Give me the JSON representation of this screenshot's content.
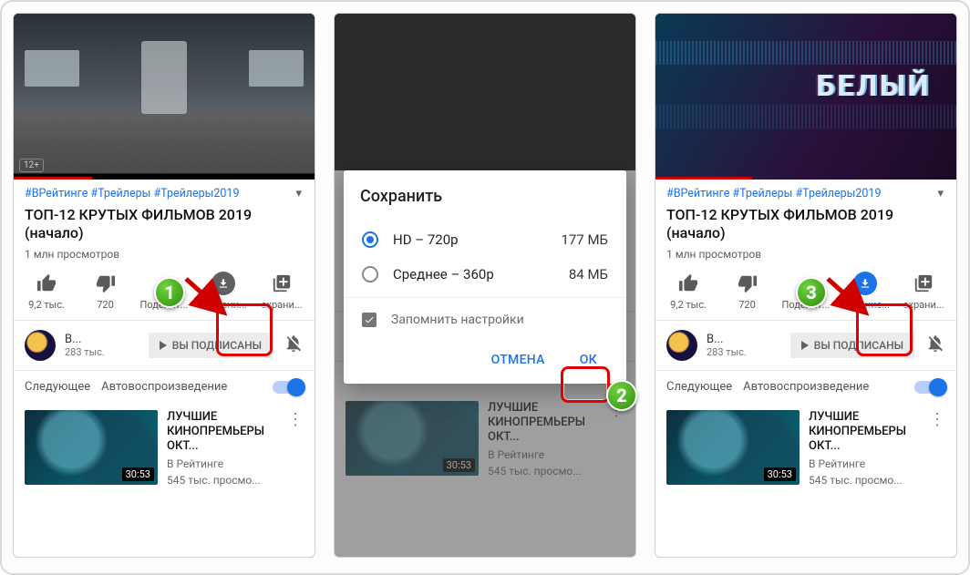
{
  "hashtags": "#ВРейтинге #Трейлеры #Трейлеры2019",
  "title": "ТОП-12 КРУТЫХ ФИЛЬМОВ 2019 (начало)",
  "views": "1 млн просмотров",
  "actions": {
    "likes": "9,2 тыс.",
    "dislikes": "720",
    "share": "Поделит...",
    "download_s1": "Сохрани...",
    "download_s3": "Ска...ние...",
    "save": "охрани..."
  },
  "channel": {
    "name": "В...",
    "subs": "283 тыс.",
    "sub_btn": "ВЫ ПОДПИСАНЫ"
  },
  "upnext": {
    "label": "Следующее",
    "autoplay": "Автовоспроизведение"
  },
  "reco": {
    "title": "ЛУЧШИЕ КИНОПРЕМЬЕРЫ ОКТ...",
    "channel": "В Рейтинге",
    "views": "545 тыс. просмо...",
    "dur": "30:53"
  },
  "glitch_text": "БЕЛЫЙ",
  "dialog": {
    "title": "Сохранить",
    "options": [
      {
        "label": "HD – 720p",
        "size": "177 МБ",
        "selected": true
      },
      {
        "label": "Среднее – 360p",
        "size": "84 МБ",
        "selected": false
      }
    ],
    "remember": "Запомнить настройки",
    "cancel": "ОТМЕНА",
    "ok": "ОК"
  },
  "steps": {
    "s1": "1",
    "s2": "2",
    "s3": "3"
  },
  "age_badge": "12+"
}
